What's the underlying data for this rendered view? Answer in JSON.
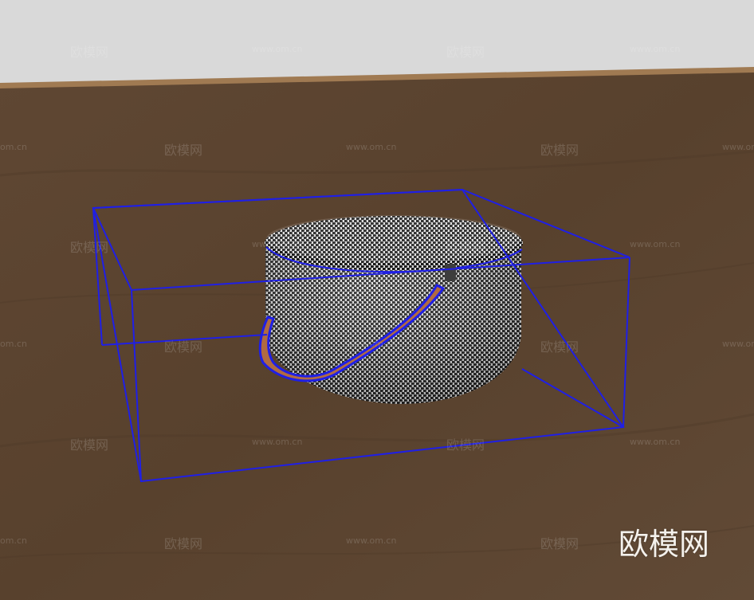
{
  "watermark": {
    "cn": "欧模网",
    "url": "www.om.cn",
    "url_partial": "om.cn"
  },
  "logo_text": "欧模网",
  "model": {
    "name": "houndstooth round ottoman with leather strap",
    "selection_color": "#1f1fe6",
    "floor_color": "#5c4530",
    "wall_color": "#d9d9d9",
    "strap_color": "#b06a42"
  }
}
